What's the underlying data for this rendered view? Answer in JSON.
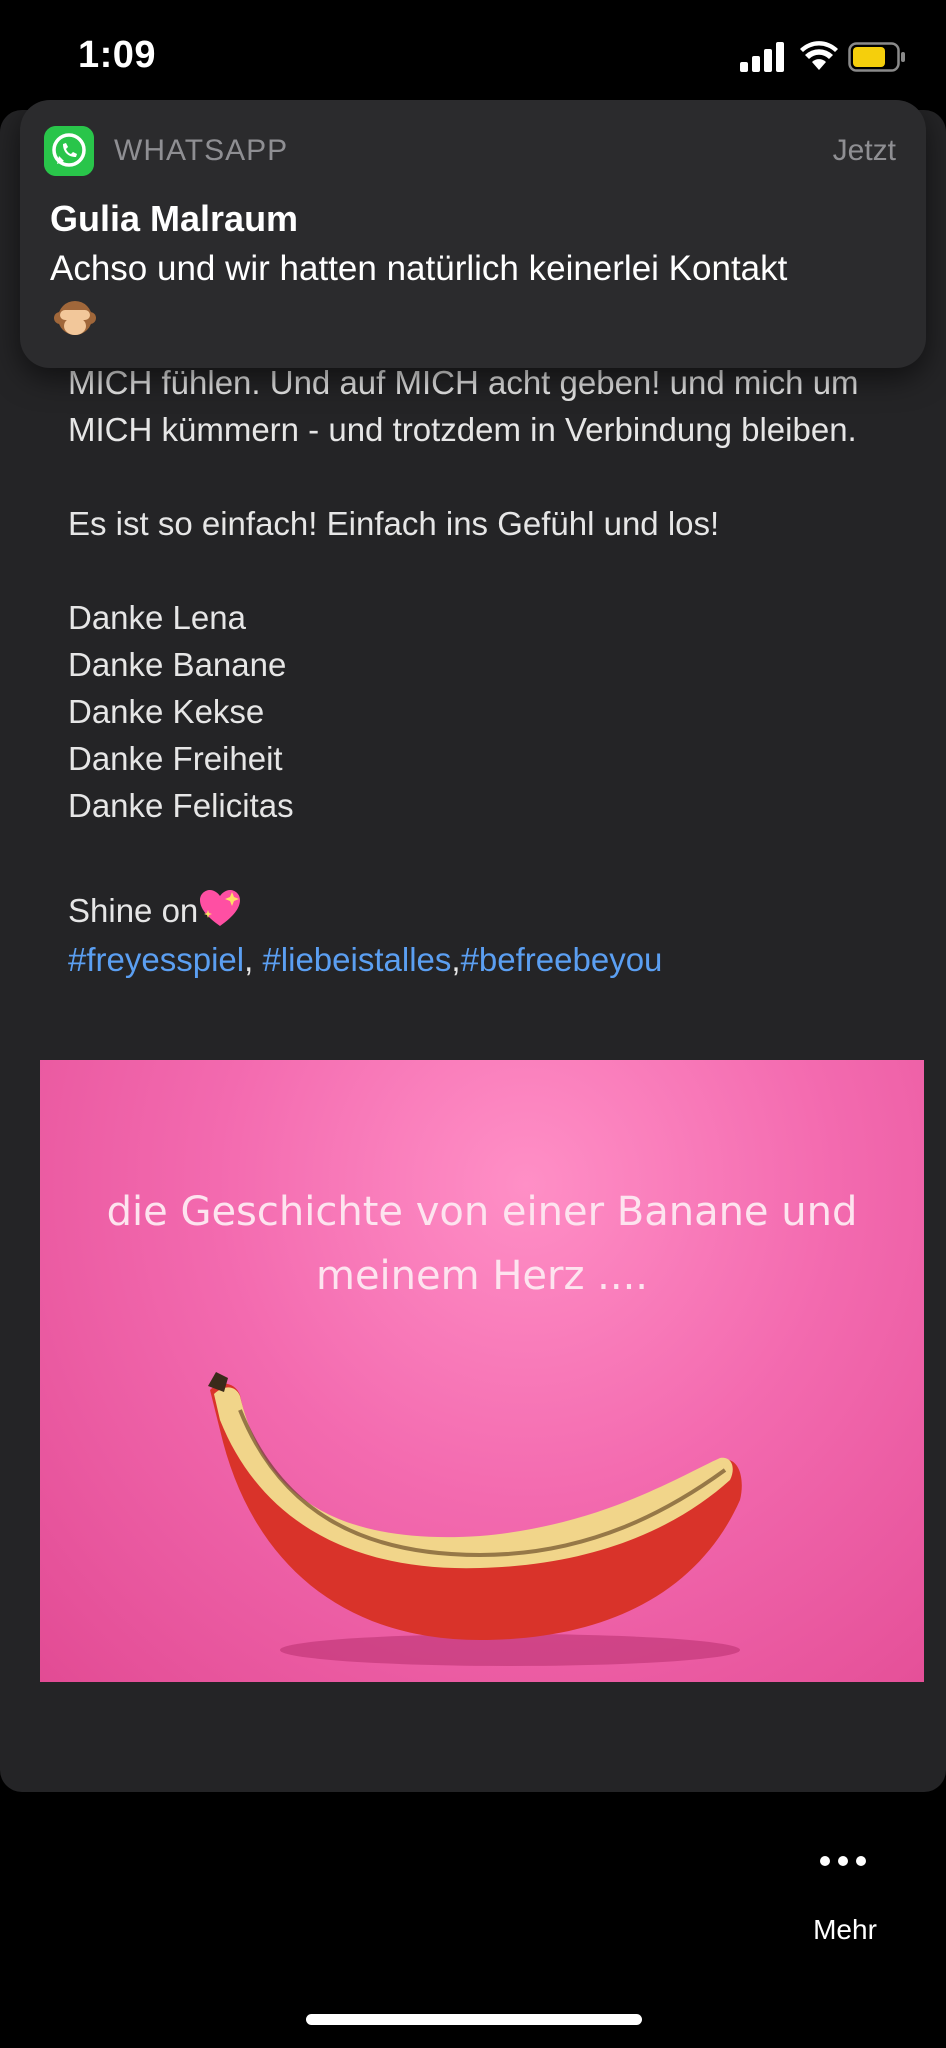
{
  "status_bar": {
    "time": "1:09"
  },
  "notification": {
    "app_name": "WHATSAPP",
    "time": "Jetzt",
    "sender": "Gulia Malraum",
    "message": "Achso und wir hatten natürlich keinerlei Kontakt"
  },
  "post": {
    "paragraph1": "Begeisterung macht sich breit, ich brauche nur noch alles raus sprechen. Ja! Ich darf MICH hier sehen! Und MICH fühlen. Und auf MICH acht geben! und mich um MICH kümmern - und trotzdem in Verbindung bleiben.",
    "paragraph2": "Es ist so einfach! Einfach ins Gefühl und los!",
    "thanks": [
      "Danke Lena",
      "Danke Banane",
      "Danke Kekse",
      "Danke Freiheit",
      "Danke Felicitas"
    ],
    "shine": "Shine on",
    "hashtags": [
      "#freyesspiel",
      "#liebeistalles",
      "#befreebeyou"
    ],
    "separators": [
      ", ",
      ","
    ]
  },
  "image": {
    "caption_line1": "die Geschichte von einer Banane und",
    "caption_line2": "meinem Herz ...."
  },
  "bottom": {
    "more_label": "Mehr"
  },
  "colors": {
    "hashtag": "#5b9ff2",
    "whatsapp_green": "#29c54a",
    "battery": "#f5cf0c"
  }
}
